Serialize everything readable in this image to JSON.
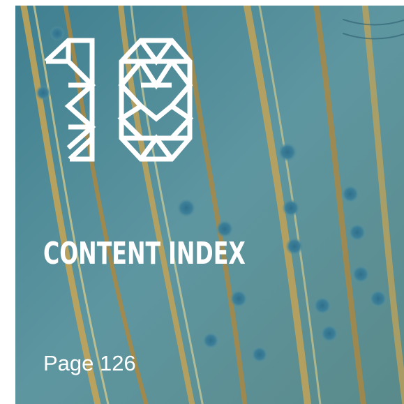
{
  "tile": {
    "number": "10",
    "title": "CONTENT INDEX",
    "page_label": "Page 126"
  },
  "colors": {
    "background_blue": "#4f8a98",
    "fiber_gold": "#b89a4a",
    "text": "#ffffff"
  },
  "icons": {
    "logo": "geometric-number-10-logo"
  }
}
